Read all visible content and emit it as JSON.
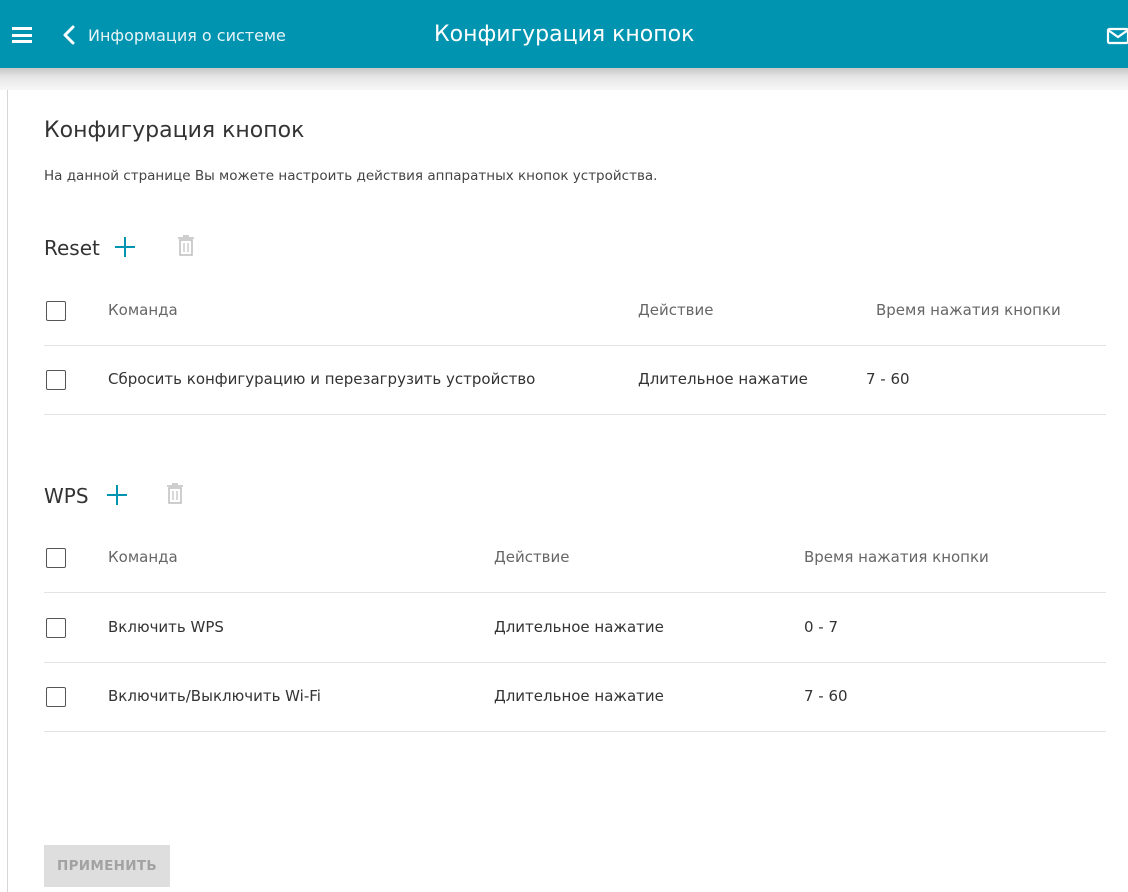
{
  "header": {
    "back_label": "Информация о системе",
    "title": "Конфигурация кнопок",
    "icons": {
      "menu": "hamburger-icon",
      "back": "chevron-left-icon",
      "mail": "mail-icon"
    },
    "color": "#0094b0"
  },
  "page": {
    "title": "Конфигурация кнопок",
    "description": "На данной странице Вы можете настроить действия аппаратных кнопок устройства."
  },
  "reset": {
    "title": "Reset",
    "columns": [
      "Команда",
      "Действие",
      "Время нажатия кнопки"
    ],
    "rows": [
      {
        "command": "Сбросить конфигурацию и перезагрузить устройство",
        "action": "Длительное нажатие",
        "time": "7 - 60"
      }
    ]
  },
  "wps": {
    "title": "WPS",
    "columns": [
      "Команда",
      "Действие",
      "Время нажатия кнопки"
    ],
    "rows": [
      {
        "command": "Включить WPS",
        "action": "Длительное нажатие",
        "time": "0 - 7"
      },
      {
        "command": "Включить/Выключить Wi-Fi",
        "action": "Длительное нажатие",
        "time": "7 - 60"
      }
    ]
  },
  "apply_label": "ПРИМЕНИТЬ"
}
